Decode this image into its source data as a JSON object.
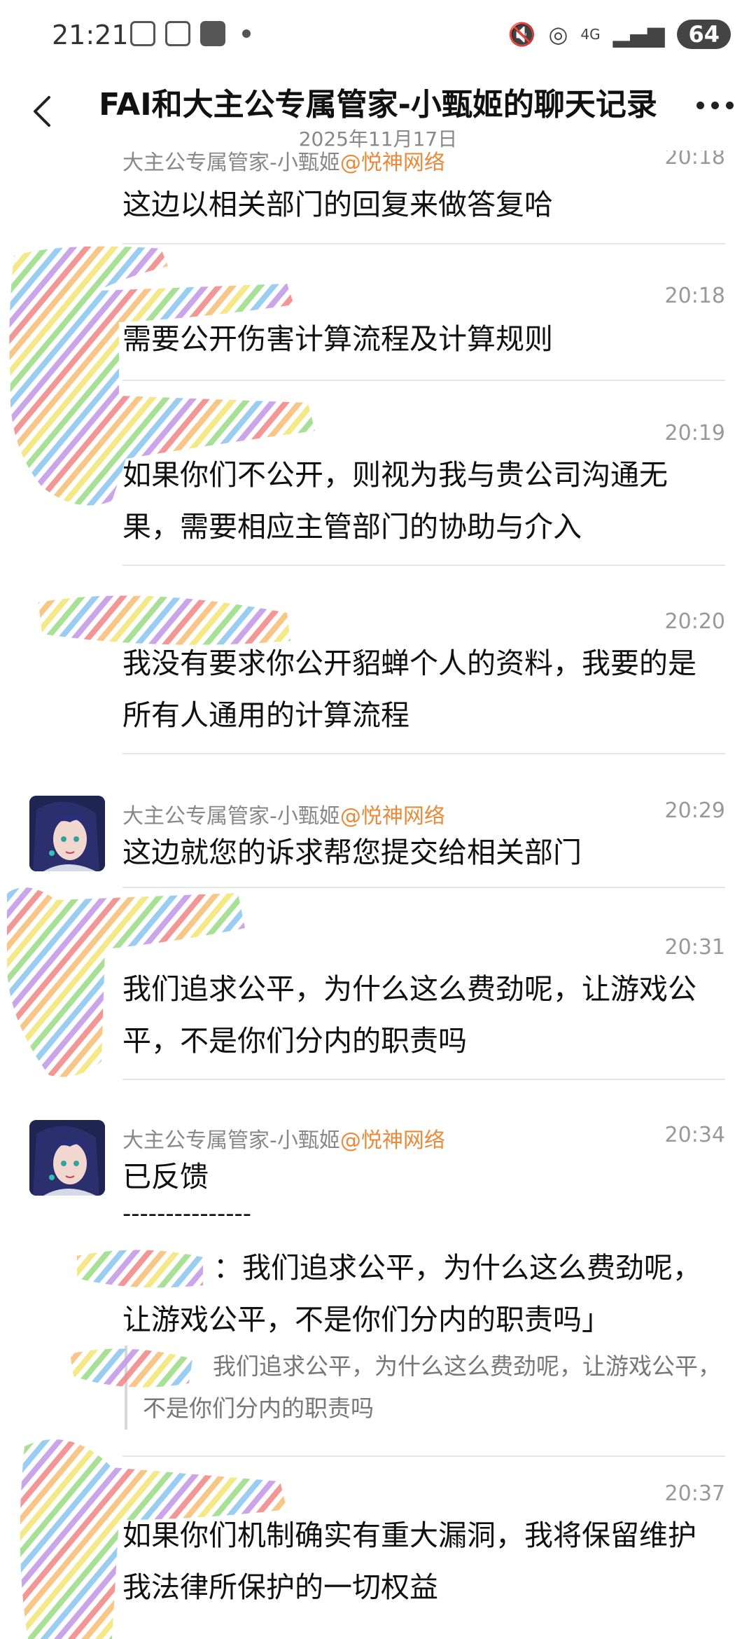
{
  "status_bar": {
    "time": "21:21",
    "network": "4G",
    "battery": "64"
  },
  "header": {
    "title": "FAI和大主公专属管家-小甄姬的聊天记录",
    "date": "2025年11月17日"
  },
  "messages": [
    {
      "sender": "大主公专属管家-小甄姬",
      "tag": "@悦神网络",
      "time": "20:18",
      "text": "这边以相关部门的回复来做答复哈"
    },
    {
      "sender": "",
      "tag": "",
      "time": "20:18",
      "text": "需要公开伤害计算流程及计算规则"
    },
    {
      "sender": "",
      "tag": "",
      "time": "20:19",
      "text": "如果你们不公开，则视为我与贵公司沟通无果，需要相应主管部门的协助与介入"
    },
    {
      "sender": "",
      "tag": "",
      "time": "20:20",
      "text": "我没有要求你公开貂蝉个人的资料，我要的是所有人通用的计算流程"
    },
    {
      "sender": "大主公专属管家-小甄姬",
      "tag": "@悦神网络",
      "time": "20:29",
      "text": "这边就您的诉求帮您提交给相关部门"
    },
    {
      "sender": "",
      "tag": "",
      "time": "20:31",
      "text": "我们追求公平，为什么这么费劲呢，让游戏公平，不是你们分内的职责吗"
    },
    {
      "sender": "大主公专属管家-小甄姬",
      "tag": "@悦神网络",
      "time": "20:34",
      "text": "已反馈",
      "separator": "---------------",
      "reply_text": "：我们追求公平，为什么这么费劲呢，让游戏公平，不是你们分内的职责吗」",
      "quote_text": "我们追求公平，为什么这么费劲呢，让游戏公平，不是你们分内的职责吗"
    },
    {
      "sender": "",
      "tag": "",
      "time": "20:37",
      "text": "如果你们机制确实有重大漏洞，我将保留维护我法律所保护的一切权益"
    }
  ]
}
